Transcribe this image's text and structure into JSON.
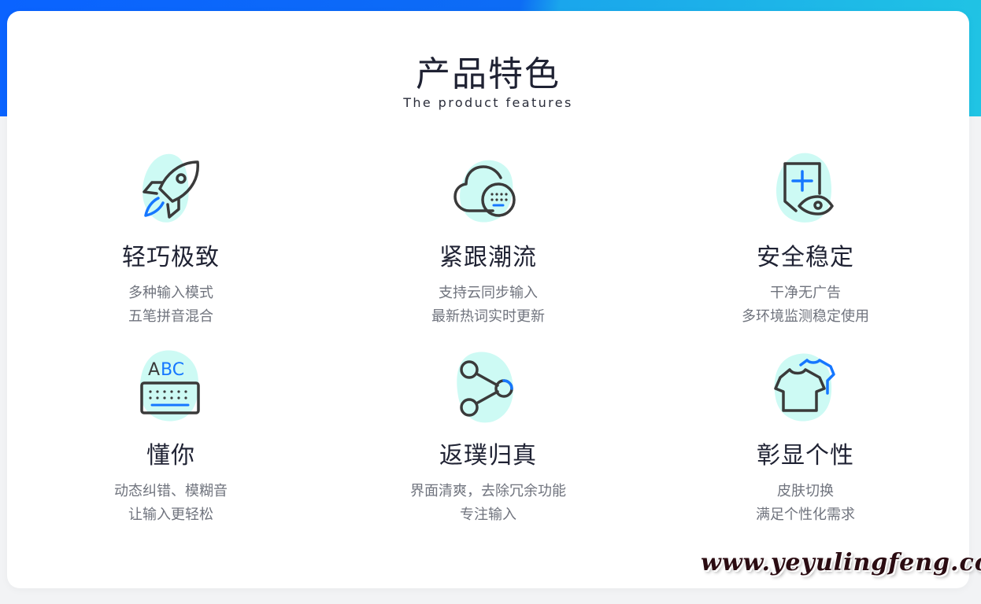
{
  "section": {
    "title": "产品特色",
    "subtitle": "The product features"
  },
  "colors": {
    "accent_blue": "#1677ff",
    "blob_cyan": "#cdfaf4",
    "icon_dark": "#3a3a3a"
  },
  "features": [
    {
      "icon": "rocket-icon",
      "title": "轻巧极致",
      "lines": [
        "多种输入模式",
        "五笔拼音混合"
      ]
    },
    {
      "icon": "cloud-keyboard-icon",
      "title": "紧跟潮流",
      "lines": [
        "支持云同步输入",
        "最新热词实时更新"
      ]
    },
    {
      "icon": "shield-eye-icon",
      "title": "安全稳定",
      "lines": [
        "干净无广告",
        "多环境监测稳定使用"
      ]
    },
    {
      "icon": "abc-keyboard-icon",
      "title": "懂你",
      "lines": [
        "动态纠错、模糊音",
        "让输入更轻松"
      ]
    },
    {
      "icon": "share-icon",
      "title": "返璞归真",
      "lines": [
        "界面清爽，去除冗余功能",
        "专注输入"
      ]
    },
    {
      "icon": "tshirt-icon",
      "title": "彰显个性",
      "lines": [
        "皮肤切换",
        "满足个性化需求"
      ]
    }
  ],
  "watermark": "www.yeyulingfeng.com"
}
